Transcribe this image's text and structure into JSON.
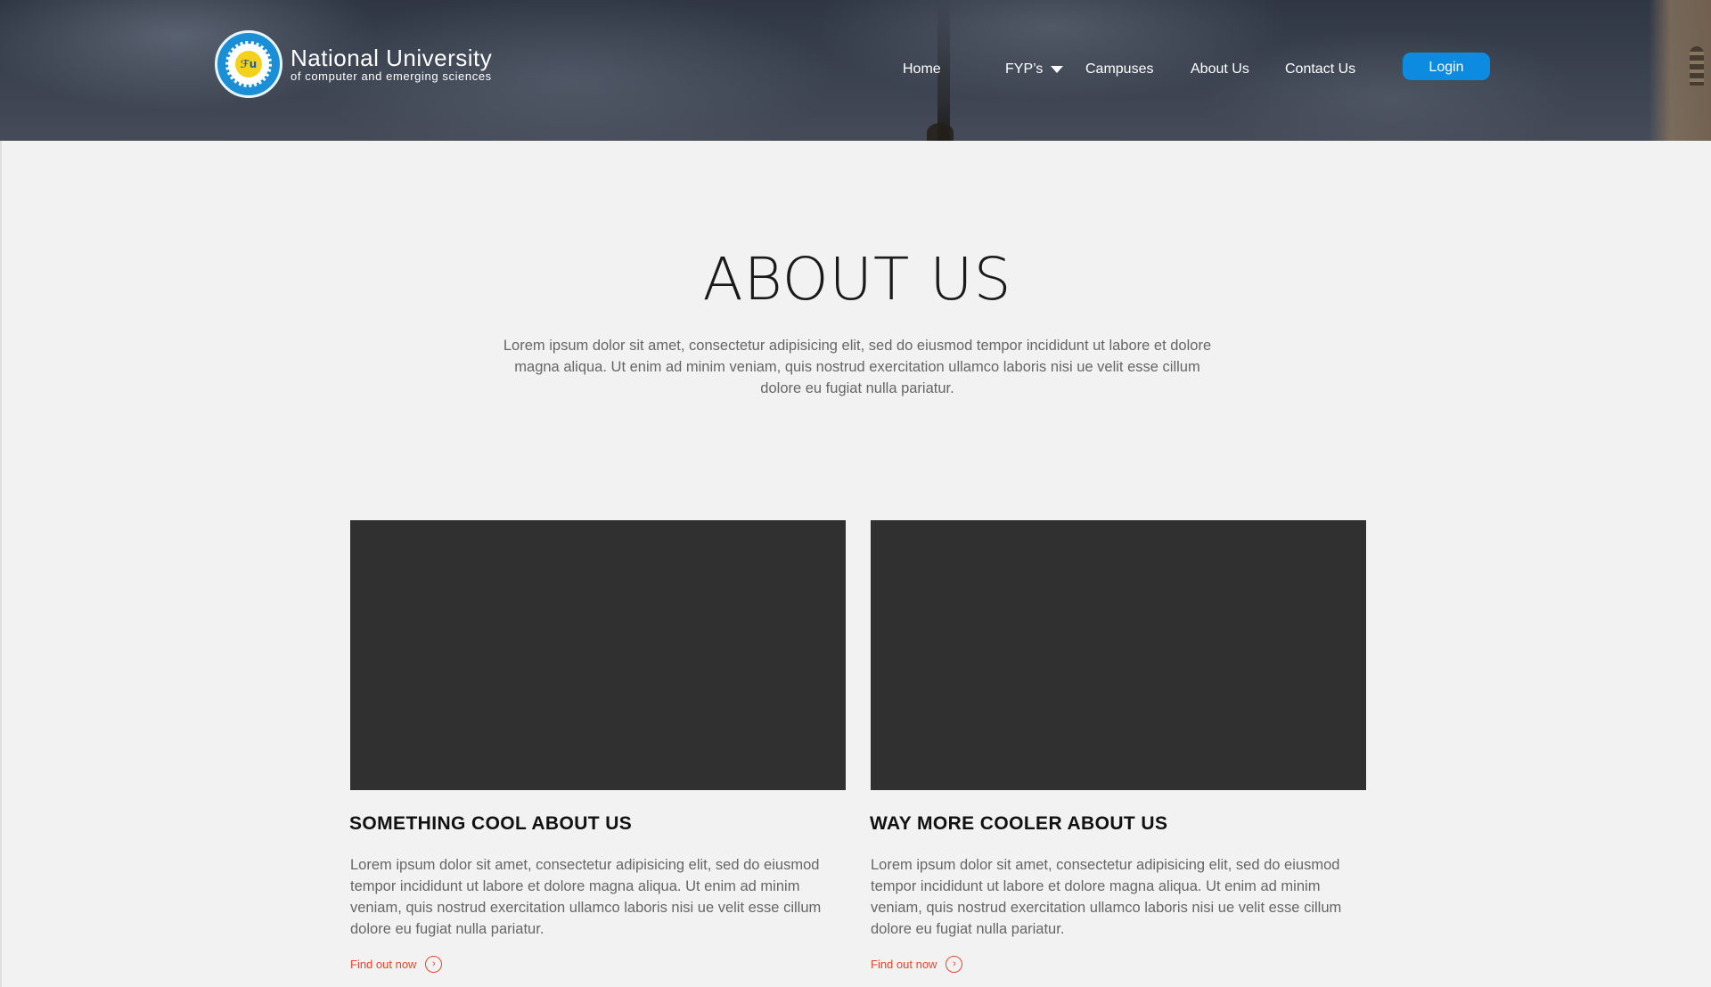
{
  "brand": {
    "name": "National University",
    "subtitle": "of computer and emerging sciences",
    "logo_icon": "university-seal"
  },
  "nav": {
    "items": [
      {
        "label": "Home"
      },
      {
        "label": "FYP’s",
        "icon": "caret-down"
      },
      {
        "label": "Campuses"
      },
      {
        "label": "About Us"
      },
      {
        "label": "Contact Us"
      }
    ],
    "login_label": "Login"
  },
  "about": {
    "title": "ABOUT US",
    "intro": "Lorem ipsum dolor sit amet, consectetur adipisicing elit, sed do eiusmod tempor incididunt ut labore et dolore magna aliqua. Ut enim ad minim veniam, quis nostrud exercitation ullamco laboris nisi ue velit esse cillum dolore eu fugiat nulla pariatur.",
    "cards": [
      {
        "title": "SOMETHING COOL ABOUT US",
        "text": "Lorem ipsum dolor sit amet, consectetur adipisicing elit, sed do eiusmod tempor incididunt ut labore et dolore magna aliqua. Ut enim ad minim veniam, quis nostrud exercitation ullamco laboris nisi ue velit esse cillum dolore eu fugiat nulla pariatur.",
        "link": "Find out now",
        "link_icon": "chevron-right-circle"
      },
      {
        "title": "WAY MORE COOLER ABOUT US",
        "text": "Lorem ipsum dolor sit amet, consectetur adipisicing elit, sed do eiusmod tempor incididunt ut labore et dolore magna aliqua. Ut enim ad minim veniam, quis nostrud exercitation ullamco laboris nisi ue velit esse cillum dolore eu fugiat nulla pariatur.",
        "link": "Find out now",
        "link_icon": "chevron-right-circle"
      }
    ]
  },
  "colors": {
    "login_button": "#0d8be0",
    "link_accent": "#e8452d",
    "card_image_placeholder": "#303030",
    "page_background": "#f2f2f2"
  }
}
